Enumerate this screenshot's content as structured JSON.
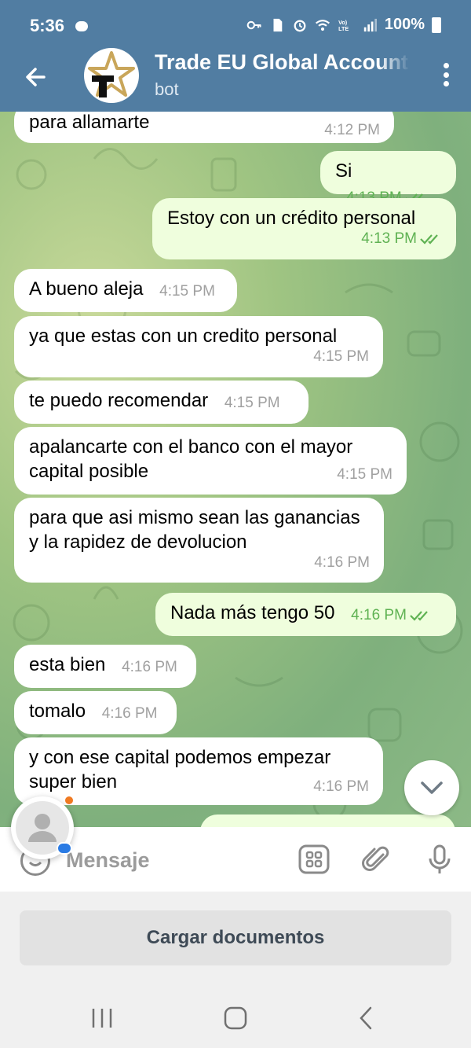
{
  "status_bar": {
    "time": "5:36",
    "battery": "100%",
    "network": "Vo)\nLTE"
  },
  "header": {
    "title": "Trade EU Global Account",
    "subtitle": "bot"
  },
  "messages": [
    {
      "dir": "in",
      "text": "para allamarte",
      "time": "4:12 PM"
    },
    {
      "dir": "out",
      "text": "Si",
      "time": "4:13 PM",
      "read": true
    },
    {
      "dir": "out",
      "text": "Estoy con un crédito personal",
      "time": "4:13 PM",
      "read": true
    },
    {
      "dir": "in",
      "text": "A bueno aleja",
      "time": "4:15 PM"
    },
    {
      "dir": "in",
      "text": "ya que estas con un credito personal",
      "time": "4:15 PM"
    },
    {
      "dir": "in",
      "text": "te puedo recomendar",
      "time": "4:15 PM"
    },
    {
      "dir": "in",
      "text": "apalancarte con el banco con el mayor capital posible",
      "time": "4:15 PM"
    },
    {
      "dir": "in",
      "text": "para que asi mismo sean las ganancias y la rapidez de devolucion",
      "time": "4:16 PM"
    },
    {
      "dir": "out",
      "text": "Nada más tengo 50",
      "time": "4:16 PM",
      "read": true
    },
    {
      "dir": "in",
      "text": "esta bien",
      "time": "4:16 PM"
    },
    {
      "dir": "in",
      "text": "tomalo",
      "time": "4:16 PM"
    },
    {
      "dir": "in",
      "text": "y con ese capital podemos empezar super bien",
      "time": "4:16 PM"
    }
  ],
  "composer": {
    "placeholder": "Mensaje"
  },
  "bottom_button": {
    "label": "Cargar documentos"
  },
  "colors": {
    "header": "#517da2",
    "out_bubble": "#effedd",
    "in_bubble": "#ffffff",
    "check": "#5fb253"
  },
  "icons": [
    "back-arrow-icon",
    "more-vertical-icon",
    "emoji-icon",
    "bot-menu-icon",
    "paperclip-icon",
    "microphone-icon",
    "chevron-down-icon"
  ]
}
